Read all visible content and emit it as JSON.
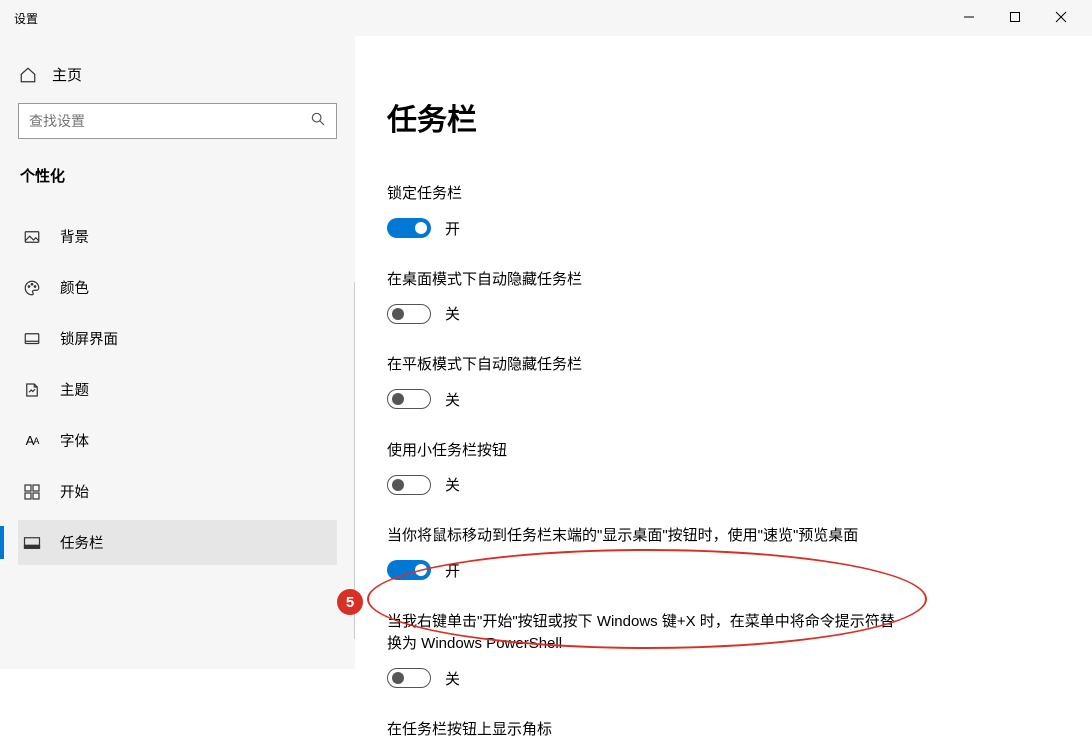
{
  "window": {
    "title": "设置"
  },
  "sidebar": {
    "home": "主页",
    "search_placeholder": "查找设置",
    "category": "个性化",
    "items": [
      {
        "label": "背景"
      },
      {
        "label": "颜色"
      },
      {
        "label": "锁屏界面"
      },
      {
        "label": "主题"
      },
      {
        "label": "字体"
      },
      {
        "label": "开始"
      },
      {
        "label": "任务栏"
      }
    ]
  },
  "page": {
    "title": "任务栏",
    "toggle_on": "开",
    "toggle_off": "关",
    "settings": [
      {
        "label": "锁定任务栏",
        "on": true
      },
      {
        "label": "在桌面模式下自动隐藏任务栏",
        "on": false
      },
      {
        "label": "在平板模式下自动隐藏任务栏",
        "on": false
      },
      {
        "label": "使用小任务栏按钮",
        "on": false
      },
      {
        "label": "当你将鼠标移动到任务栏末端的\"显示桌面\"按钮时，使用\"速览\"预览桌面",
        "on": true
      },
      {
        "label": "当我右键单击\"开始\"按钮或按下 Windows 键+X 时，在菜单中将命令提示符替换为 Windows PowerShell",
        "on": false
      },
      {
        "label": "在任务栏按钮上显示角标",
        "on": null
      }
    ]
  },
  "annotation": {
    "badge": "5"
  }
}
